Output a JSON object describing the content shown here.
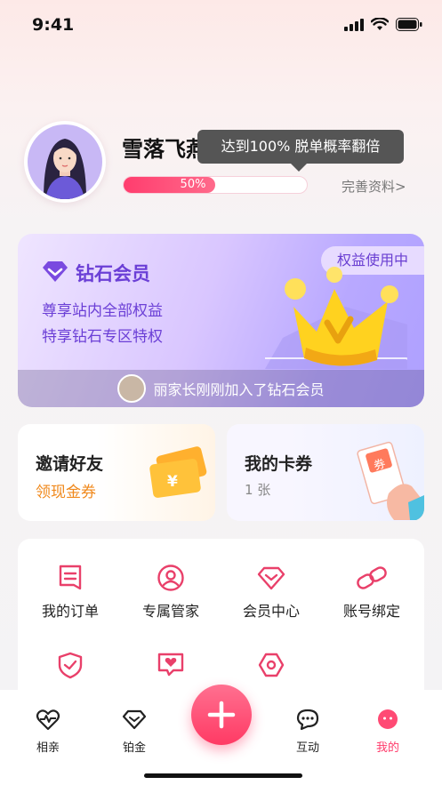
{
  "status_bar": {
    "time": "9:41"
  },
  "profile": {
    "name": "雪落飞燕",
    "progress_percent": 50,
    "progress_label": "50%",
    "tooltip": "达到100% 脱单概率翻倍",
    "complete_link": "完善资料>"
  },
  "vip_card": {
    "title": "钻石会员",
    "desc_line1": "尊享站内全部权益",
    "desc_line2": "特享钻石专区特权",
    "badge": "权益使用中",
    "footer": "丽家长刚刚加入了钻石会员"
  },
  "cards": {
    "invite": {
      "title": "邀请好友",
      "subtitle": "领现金券"
    },
    "coupons": {
      "title": "我的卡券",
      "subtitle": "1 张",
      "ticket_text": "券"
    }
  },
  "menu": {
    "row1": [
      {
        "label": "我的订单",
        "icon": "order-icon"
      },
      {
        "label": "专属管家",
        "icon": "butler-icon"
      },
      {
        "label": "会员中心",
        "icon": "member-icon"
      },
      {
        "label": "账号绑定",
        "icon": "link-icon"
      }
    ],
    "row2": [
      {
        "icon": "shield-check-icon"
      },
      {
        "icon": "heart-message-icon"
      },
      {
        "icon": "hexagon-icon"
      }
    ]
  },
  "tab_bar": {
    "tabs": [
      {
        "label": "相亲",
        "icon": "heartbeat-icon"
      },
      {
        "label": "铂金",
        "icon": "diamond-icon"
      },
      {
        "label": "互动",
        "icon": "chat-icon"
      },
      {
        "label": "我的",
        "icon": "profile-face-icon"
      }
    ],
    "active_tab": "我的"
  },
  "colors": {
    "accent_pink": "#ff3b6b",
    "vip_purple": "#6b3fd6",
    "coupon_orange": "#f0891c",
    "menu_icon": "#e9406a"
  }
}
